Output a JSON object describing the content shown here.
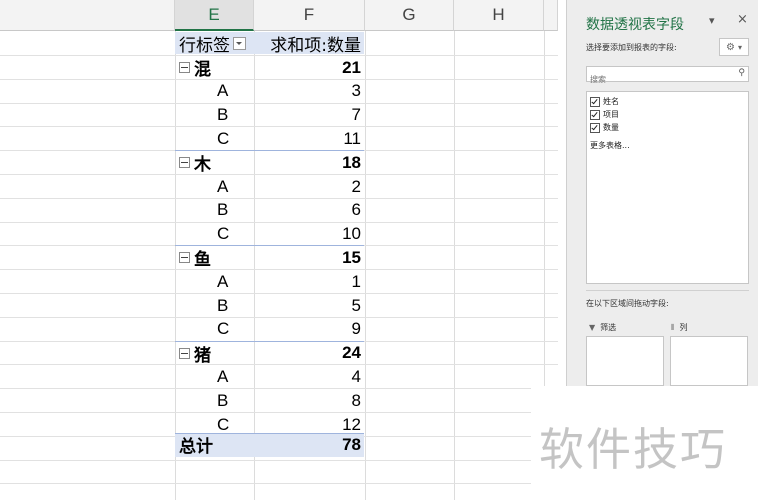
{
  "columns": [
    "E",
    "F",
    "G",
    "H"
  ],
  "pivot": {
    "row_label_header": "行标签",
    "sum_header": "求和项:数量",
    "groups": [
      {
        "name": "混",
        "total": "21",
        "items": [
          {
            "label": "A",
            "value": "3"
          },
          {
            "label": "B",
            "value": "7"
          },
          {
            "label": "C",
            "value": "11"
          }
        ]
      },
      {
        "name": "木",
        "total": "18",
        "items": [
          {
            "label": "A",
            "value": "2"
          },
          {
            "label": "B",
            "value": "6"
          },
          {
            "label": "C",
            "value": "10"
          }
        ]
      },
      {
        "name": "鱼",
        "total": "15",
        "items": [
          {
            "label": "A",
            "value": "1"
          },
          {
            "label": "B",
            "value": "5"
          },
          {
            "label": "C",
            "value": "9"
          }
        ]
      },
      {
        "name": "猪",
        "total": "24",
        "items": [
          {
            "label": "A",
            "value": "4"
          },
          {
            "label": "B",
            "value": "8"
          },
          {
            "label": "C",
            "value": "12"
          }
        ]
      }
    ],
    "grand_total_label": "总计",
    "grand_total": "78"
  },
  "pane": {
    "title": "数据透视表字段",
    "subtitle": "选择要添加到报表的字段:",
    "search_placeholder": "搜索",
    "fields": [
      "姓名",
      "项目",
      "数量"
    ],
    "more_tables": "更多表格...",
    "drag_hint": "在以下区域间拖动字段:",
    "areas": [
      "筛选",
      "列"
    ]
  },
  "watermark": "软件技巧",
  "colors": {
    "accent": "#217346",
    "pivot_band": "#dde5f4",
    "pivot_line": "#9fb4dd"
  }
}
